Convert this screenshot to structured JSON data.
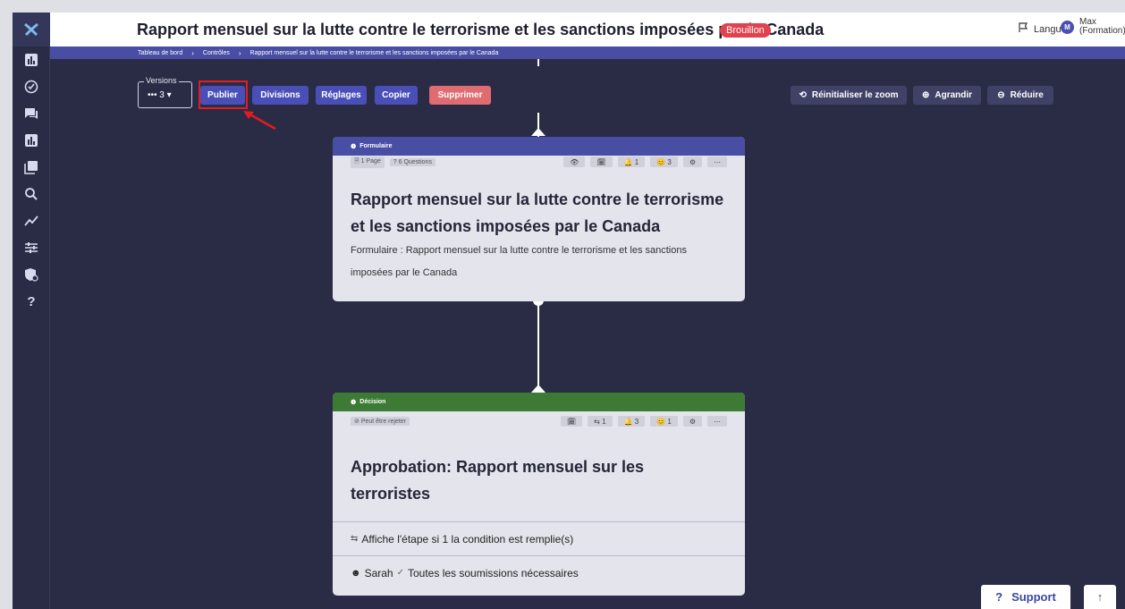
{
  "header": {
    "title": "Rapport mensuel sur la lutte contre le terrorisme et les sanctions imposées par le Canada",
    "status_badge": "Brouillon",
    "language_label": "Langue",
    "user_initial": "M",
    "user_name": "Max",
    "user_role": "(Formation)"
  },
  "breadcrumb": [
    "Tableau de bord",
    "Contrôles",
    "Rapport mensuel sur la lutte contre le terrorisme et les sanctions imposées par le Canada"
  ],
  "toolbar": {
    "versions_label": "Versions",
    "versions_value": "••• 3 ▾",
    "publish": "Publier",
    "divisions": "Divisions",
    "settings": "Réglages",
    "copy": "Copier",
    "delete": "Supprimer",
    "reset_zoom": "Réinitialiser le zoom",
    "zoom_in": "Agrandir",
    "zoom_out": "Réduire"
  },
  "form_card": {
    "type": "Formulaire",
    "pages": "1 Page",
    "questions": "6 Questions",
    "tools": [
      "👁",
      "🗓",
      "🔔 1",
      "😊 3",
      "⚙",
      "⋯"
    ],
    "title": "Rapport mensuel sur la lutte contre le terrorisme et les sanctions imposées par le Canada",
    "description": "Formulaire : Rapport mensuel sur la lutte contre le terrorisme et les sanctions imposées par le Canada"
  },
  "decision_card": {
    "type": "Décision",
    "reject_chip": "Peut être rejeter",
    "tools": [
      "🗓",
      "⇆ 1",
      "🔔 3",
      "😊 1",
      "⚙",
      "⋯"
    ],
    "title": "Approbation: Rapport mensuel sur les terroristes",
    "condition": "Affiche l'étape si 1 la condition est remplie(s)",
    "assignee": "Sarah",
    "submissions": "Toutes les soumissions nécessaires"
  },
  "support": {
    "label": "Support"
  },
  "colors": {
    "background": "#2a2c46",
    "accent": "#4a4fb8",
    "danger": "#e06b70",
    "decision": "#3d7a35",
    "form": "#474ea4"
  }
}
